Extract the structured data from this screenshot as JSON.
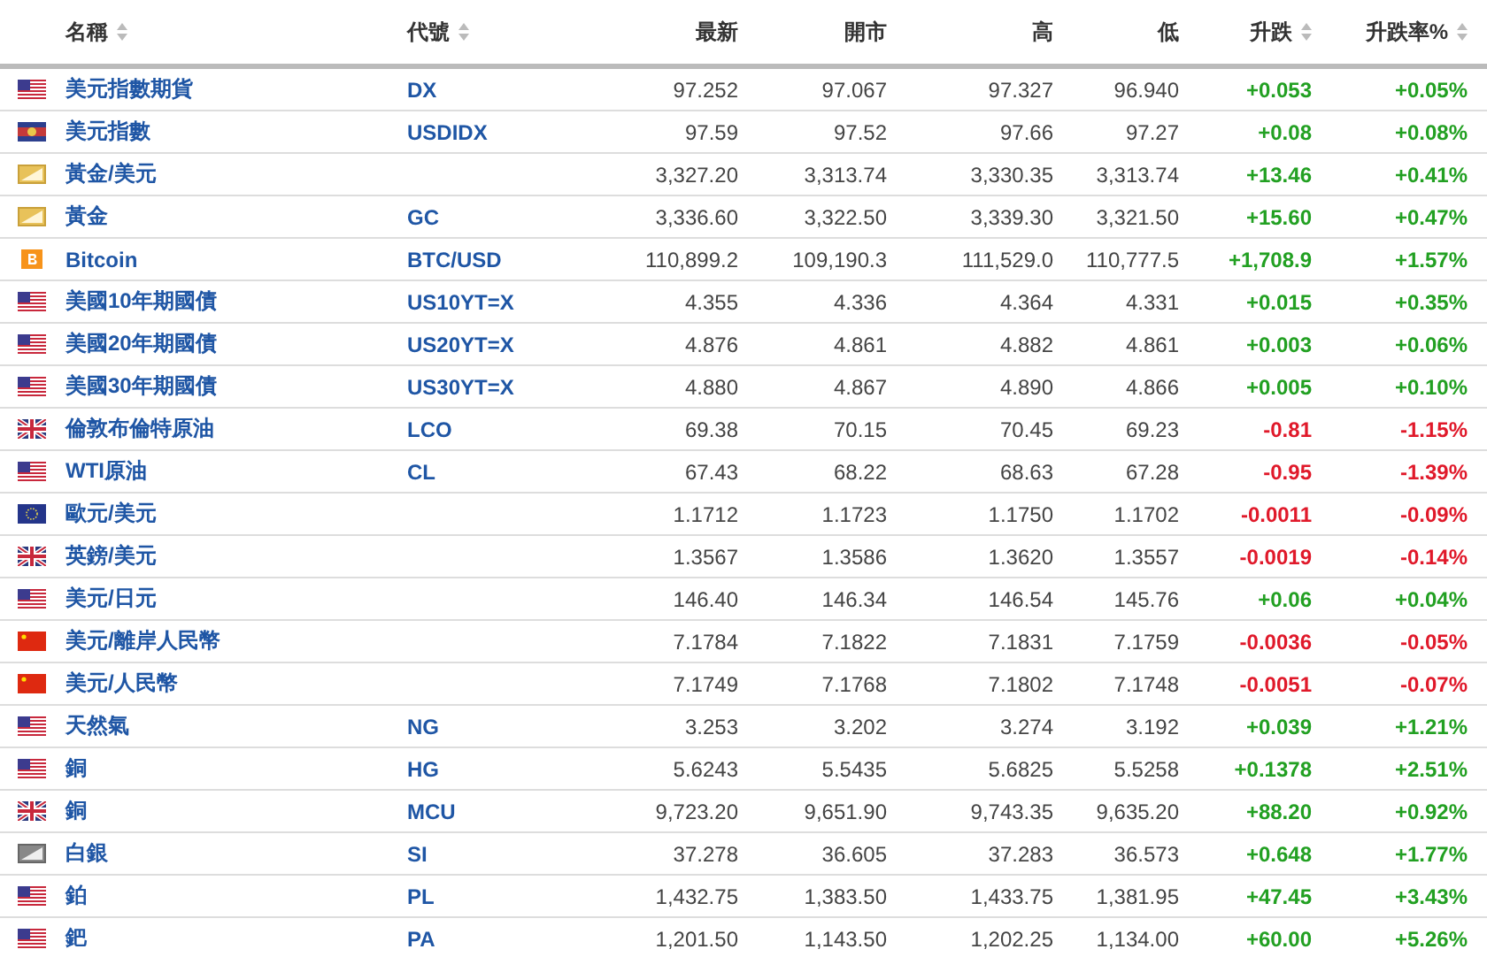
{
  "table": {
    "columns": [
      {
        "label": "名稱",
        "sortable": true
      },
      {
        "label": "代號",
        "sortable": true
      },
      {
        "label": "最新",
        "sortable": false
      },
      {
        "label": "開市",
        "sortable": false
      },
      {
        "label": "高",
        "sortable": false
      },
      {
        "label": "低",
        "sortable": false
      },
      {
        "label": "升跌",
        "sortable": true
      },
      {
        "label": "升跌率%",
        "sortable": true
      }
    ],
    "rows": [
      {
        "kind": "us",
        "name": "美元指數期貨",
        "code": "DX",
        "last": "97.252",
        "open": "97.067",
        "high": "97.327",
        "low": "96.940",
        "change": "+0.053",
        "pct": "+0.05%",
        "color": "#22a022"
      },
      {
        "kind": "asean",
        "name": "美元指數",
        "code": "USDIDX",
        "last": "97.59",
        "open": "97.52",
        "high": "97.66",
        "low": "97.27",
        "change": "+0.08",
        "pct": "+0.08%",
        "color": "#22a022"
      },
      {
        "kind": "gold",
        "name": "黃金/美元",
        "last": "3,327.20",
        "open": "3,313.74",
        "high": "3,330.35",
        "low": "3,313.74",
        "change": "+13.46",
        "pct": "+0.41%",
        "color": "#22a022"
      },
      {
        "kind": "gold",
        "name": "黃金",
        "code": "GC",
        "last": "3,336.60",
        "open": "3,322.50",
        "high": "3,339.30",
        "low": "3,321.50",
        "change": "+15.60",
        "pct": "+0.47%",
        "color": "#22a022"
      },
      {
        "kind": "btc",
        "name": "Bitcoin",
        "code": "BTC/USD",
        "last": "110,899.2",
        "open": "109,190.3",
        "high": "111,529.0",
        "low": "110,777.5",
        "change": "+1,708.9",
        "pct": "+1.57%",
        "color": "#22a022"
      },
      {
        "kind": "us",
        "name": "美國10年期國債",
        "code": "US10YT=X",
        "last": "4.355",
        "open": "4.336",
        "high": "4.364",
        "low": "4.331",
        "change": "+0.015",
        "pct": "+0.35%",
        "color": "#22a022"
      },
      {
        "kind": "us",
        "name": "美國20年期國債",
        "code": "US20YT=X",
        "last": "4.876",
        "open": "4.861",
        "high": "4.882",
        "low": "4.861",
        "change": "+0.003",
        "pct": "+0.06%",
        "color": "#22a022"
      },
      {
        "kind": "us",
        "name": "美國30年期國債",
        "code": "US30YT=X",
        "last": "4.880",
        "open": "4.867",
        "high": "4.890",
        "low": "4.866",
        "change": "+0.005",
        "pct": "+0.10%",
        "color": "#22a022"
      },
      {
        "kind": "uk",
        "name": "倫敦布倫特原油",
        "code": "LCO",
        "last": "69.38",
        "open": "70.15",
        "high": "70.45",
        "low": "69.23",
        "change": "-0.81",
        "pct": "-1.15%",
        "color": "#e0192a"
      },
      {
        "kind": "us",
        "name": "WTI原油",
        "code": "CL",
        "last": "67.43",
        "open": "68.22",
        "high": "68.63",
        "low": "67.28",
        "change": "-0.95",
        "pct": "-1.39%",
        "color": "#e0192a"
      },
      {
        "kind": "eu",
        "name": "歐元/美元",
        "last": "1.1712",
        "open": "1.1723",
        "high": "1.1750",
        "low": "1.1702",
        "change": "-0.0011",
        "pct": "-0.09%",
        "color": "#e0192a"
      },
      {
        "kind": "uk",
        "name": "英鎊/美元",
        "last": "1.3567",
        "open": "1.3586",
        "high": "1.3620",
        "low": "1.3557",
        "change": "-0.0019",
        "pct": "-0.14%",
        "color": "#e0192a"
      },
      {
        "kind": "us",
        "name": "美元/日元",
        "last": "146.40",
        "open": "146.34",
        "high": "146.54",
        "low": "145.76",
        "change": "+0.06",
        "pct": "+0.04%",
        "color": "#22a022"
      },
      {
        "kind": "cn",
        "name": "美元/離岸人民幣",
        "last": "7.1784",
        "open": "7.1822",
        "high": "7.1831",
        "low": "7.1759",
        "change": "-0.0036",
        "pct": "-0.05%",
        "color": "#e0192a"
      },
      {
        "kind": "cn",
        "name": "美元/人民幣",
        "last": "7.1749",
        "open": "7.1768",
        "high": "7.1802",
        "low": "7.1748",
        "change": "-0.0051",
        "pct": "-0.07%",
        "color": "#e0192a"
      },
      {
        "kind": "us",
        "name": "天然氣",
        "code": "NG",
        "last": "3.253",
        "open": "3.202",
        "high": "3.274",
        "low": "3.192",
        "change": "+0.039",
        "pct": "+1.21%",
        "color": "#22a022"
      },
      {
        "kind": "us",
        "name": "銅",
        "code": "HG",
        "last": "5.6243",
        "open": "5.5435",
        "high": "5.6825",
        "low": "5.5258",
        "change": "+0.1378",
        "pct": "+2.51%",
        "color": "#22a022"
      },
      {
        "kind": "uk",
        "name": "銅",
        "code": "MCU",
        "last": "9,723.20",
        "open": "9,651.90",
        "high": "9,743.35",
        "low": "9,635.20",
        "change": "+88.20",
        "pct": "+0.92%",
        "color": "#22a022"
      },
      {
        "kind": "silver",
        "name": "白銀",
        "code": "SI",
        "last": "37.278",
        "open": "36.605",
        "high": "37.283",
        "low": "36.573",
        "change": "+0.648",
        "pct": "+1.77%",
        "color": "#22a022"
      },
      {
        "kind": "us",
        "name": "鉑",
        "code": "PL",
        "last": "1,432.75",
        "open": "1,383.50",
        "high": "1,433.75",
        "low": "1,381.95",
        "change": "+47.45",
        "pct": "+3.43%",
        "color": "#22a022"
      },
      {
        "kind": "us",
        "name": "鈀",
        "code": "PA",
        "last": "1,201.50",
        "open": "1,143.50",
        "high": "1,202.25",
        "low": "1,134.00",
        "change": "+60.00",
        "pct": "+5.26%",
        "color": "#22a022"
      }
    ]
  }
}
